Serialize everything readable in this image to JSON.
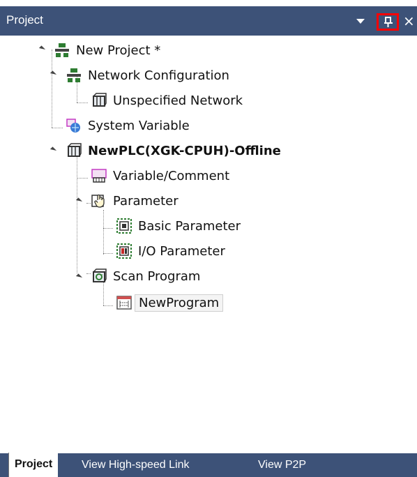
{
  "panel": {
    "title": "Project",
    "controls": [
      "dropdown-arrow-icon",
      "pin-icon",
      "close-icon"
    ]
  },
  "tree": [
    {
      "label": "New Project *",
      "icon": "project-icon"
    },
    {
      "label": "Network Configuration",
      "icon": "network-config-icon"
    },
    {
      "label": "Unspecified Network",
      "icon": "plc-module-icon"
    },
    {
      "label": "System Variable",
      "icon": "system-variable-icon"
    },
    {
      "label": "NewPLC(XGK-CPUH)-Offline",
      "icon": "plc-module-icon"
    },
    {
      "label": "Variable/Comment",
      "icon": "variable-comment-icon"
    },
    {
      "label": "Parameter",
      "icon": "parameter-hand-icon"
    },
    {
      "label": "Basic Parameter",
      "icon": "basic-parameter-icon"
    },
    {
      "label": "I/O Parameter",
      "icon": "io-parameter-icon"
    },
    {
      "label": "Scan Program",
      "icon": "scan-program-icon"
    },
    {
      "label": "NewProgram",
      "icon": "program-ladder-icon"
    }
  ],
  "tabs": [
    "Project",
    "View High-speed Link",
    "View P2P"
  ],
  "colors": {
    "titlebar": "#3d5278",
    "pin_highlight": "#ff0000"
  }
}
